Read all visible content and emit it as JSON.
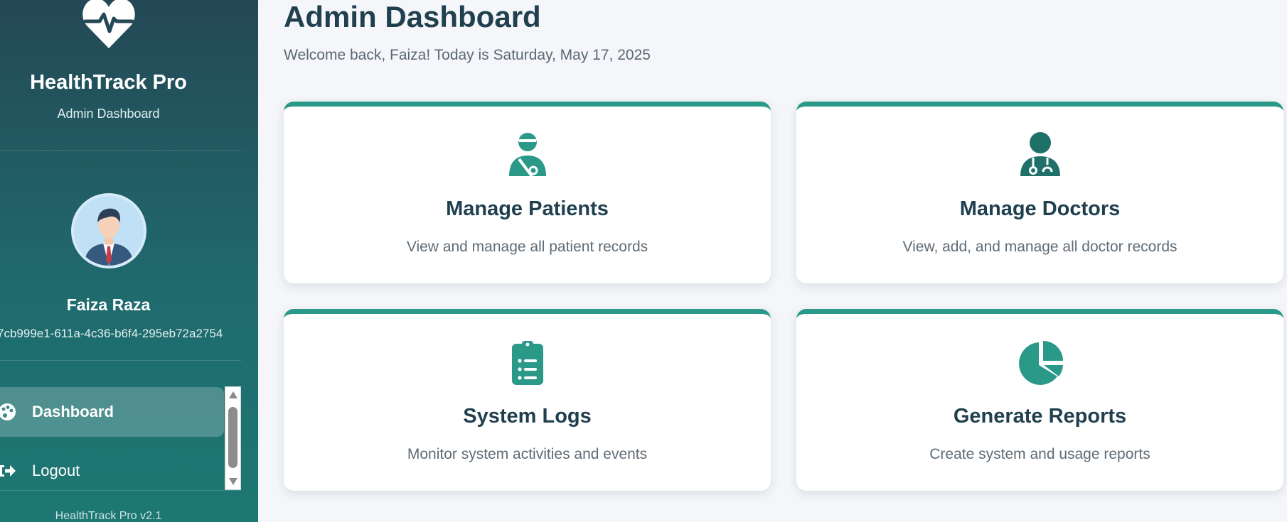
{
  "sidebar": {
    "brand": "HealthTrack Pro",
    "brand_subtitle": "Admin Dashboard",
    "user": {
      "name": "Faiza Raza",
      "id": "7cb999e1-611a-4c36-b6f4-295eb72a2754"
    },
    "nav": [
      {
        "label": "Dashboard",
        "icon": "palette-icon",
        "active": true
      },
      {
        "label": "Logout",
        "icon": "logout-icon",
        "active": false
      }
    ],
    "footer": "HealthTrack Pro v2.1"
  },
  "main": {
    "title": "Admin Dashboard",
    "welcome": "Welcome back, Faiza! Today is Saturday, May 17, 2025",
    "cards": [
      {
        "title": "Manage Patients",
        "description": "View and manage all patient records",
        "icon": "patient-icon"
      },
      {
        "title": "Manage Doctors",
        "description": "View, add, and manage all doctor records",
        "icon": "doctor-icon"
      },
      {
        "title": "System Logs",
        "description": "Monitor system activities and events",
        "icon": "clipboard-list-icon"
      },
      {
        "title": "Generate Reports",
        "description": "Create system and usage reports",
        "icon": "pie-chart-icon"
      }
    ]
  },
  "colors": {
    "sidebar_top": "#244855",
    "sidebar_bottom": "#1d7873",
    "accent": "#2a9988",
    "heading": "#20404f",
    "background": "#f4f6f9"
  }
}
